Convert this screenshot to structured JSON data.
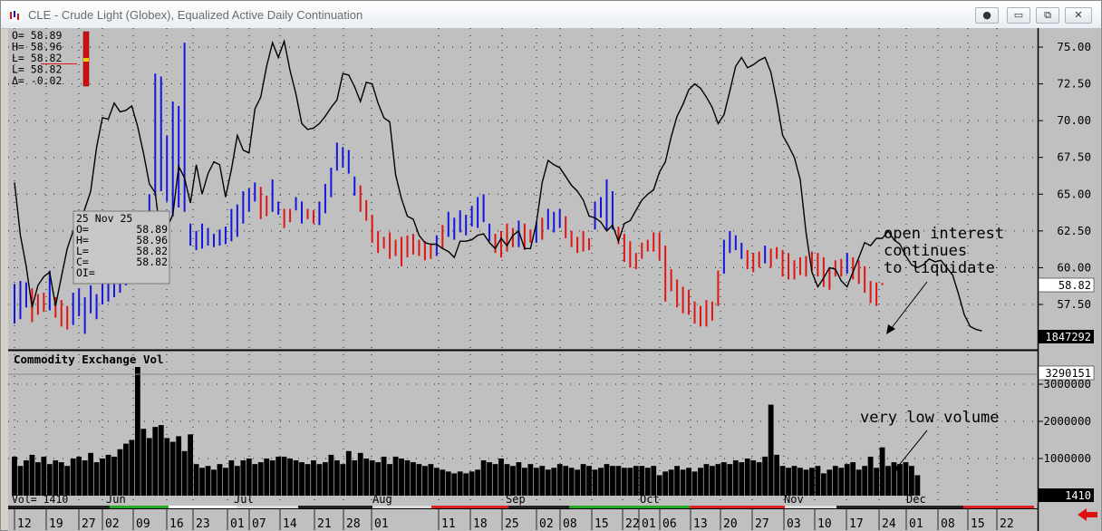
{
  "window": {
    "title": "CLE - Crude Light (Globex), Equalized Active Daily Continuation",
    "buttons": [
      "●",
      "▭",
      "⧉",
      "✕"
    ]
  },
  "ohlc_box": {
    "o": "O=   58.89",
    "h": "H=   58.96",
    "l": "L=   58.82",
    "l2": "L=   58.82",
    "d": "Δ=   -0.02"
  },
  "tooltip": {
    "date": "25 Nov 25",
    "rows": [
      {
        "k": "O=",
        "v": "58.89"
      },
      {
        "k": "H=",
        "v": "58.96"
      },
      {
        "k": "L=",
        "v": "58.82"
      },
      {
        "k": "C=",
        "v": "58.82"
      },
      {
        "k": "OI=",
        "v": ""
      }
    ]
  },
  "annotations": {
    "oi_line1": "open interest",
    "oi_line2": "continues",
    "oi_line3": "to liquidate",
    "vol": "very low volume"
  },
  "volume_panel": {
    "title": "Commodity Exchange Vol",
    "vol_readout": "Vol=     1410",
    "last_value": "1410",
    "oi_value": "1847292",
    "max_value": "3290151"
  },
  "price_last": "58.82",
  "colors": {
    "up": "#1414e0",
    "down": "#e01414",
    "oi_line": "#000000",
    "bg": "#c0c0c0"
  },
  "chart_data": [
    {
      "type": "ohlc",
      "title": "CLE - Crude Light (Globex), Equalized Active Daily Continuation",
      "ylim": [
        55.5,
        76.0
      ],
      "y_ticks": [
        "75.00",
        "72.50",
        "70.00",
        "67.50",
        "65.00",
        "62.50",
        "60.00",
        "57.50"
      ],
      "month_labels": [
        "Jun",
        "Jul",
        "Aug",
        "Sep",
        "Oct",
        "Nov",
        "Dec"
      ],
      "day_labels": [
        "12",
        "19",
        "27",
        "02",
        "09",
        "16",
        "23",
        "01",
        "07",
        "14",
        "21",
        "28",
        "01",
        "11",
        "18",
        "25",
        "02",
        "08",
        "15",
        "22",
        "01",
        "06",
        "13",
        "20",
        "27",
        "03",
        "10",
        "17",
        "24",
        "01",
        "08",
        "15",
        "22"
      ],
      "bars": [
        {
          "h": 58.9,
          "l": 56.2,
          "d": 1
        },
        {
          "h": 59.1,
          "l": 56.5,
          "d": 1
        },
        {
          "h": 59.0,
          "l": 57.3,
          "d": 1
        },
        {
          "h": 58.6,
          "l": 56.3,
          "d": -1
        },
        {
          "h": 58.2,
          "l": 56.8,
          "d": -1
        },
        {
          "h": 58.3,
          "l": 57.0,
          "d": -1
        },
        {
          "h": 59.8,
          "l": 57.1,
          "d": 1
        },
        {
          "h": 58.0,
          "l": 56.6,
          "d": -1
        },
        {
          "h": 57.8,
          "l": 56.0,
          "d": -1
        },
        {
          "h": 57.4,
          "l": 55.8,
          "d": -1
        },
        {
          "h": 58.3,
          "l": 56.1,
          "d": 1
        },
        {
          "h": 58.6,
          "l": 56.7,
          "d": 1
        },
        {
          "h": 58.0,
          "l": 55.5,
          "d": 1
        },
        {
          "h": 58.8,
          "l": 56.9,
          "d": 1
        },
        {
          "h": 58.2,
          "l": 56.5,
          "d": 1
        },
        {
          "h": 59.3,
          "l": 57.5,
          "d": 1
        },
        {
          "h": 59.6,
          "l": 57.7,
          "d": 1
        },
        {
          "h": 60.0,
          "l": 58.0,
          "d": 1
        },
        {
          "h": 59.5,
          "l": 58.3,
          "d": 1
        },
        {
          "h": 60.5,
          "l": 58.8,
          "d": 1
        },
        {
          "h": 61.6,
          "l": 59.5,
          "d": 1
        },
        {
          "h": 61.2,
          "l": 59.6,
          "d": 1
        },
        {
          "h": 63.2,
          "l": 60.6,
          "d": 1
        },
        {
          "h": 65.0,
          "l": 62.8,
          "d": 1
        },
        {
          "h": 73.2,
          "l": 64.9,
          "d": 1
        },
        {
          "h": 73.0,
          "l": 65.2,
          "d": 1
        },
        {
          "h": 69.0,
          "l": 64.5,
          "d": 1
        },
        {
          "h": 71.3,
          "l": 63.5,
          "d": 1
        },
        {
          "h": 71.0,
          "l": 64.1,
          "d": 1
        },
        {
          "h": 75.3,
          "l": 63.8,
          "d": 1
        },
        {
          "h": 63.0,
          "l": 61.5,
          "d": 1
        },
        {
          "h": 62.5,
          "l": 61.2,
          "d": 1
        },
        {
          "h": 63.0,
          "l": 61.3,
          "d": 1
        },
        {
          "h": 62.7,
          "l": 61.5,
          "d": 1
        },
        {
          "h": 62.3,
          "l": 61.4,
          "d": 1
        },
        {
          "h": 62.6,
          "l": 61.5,
          "d": 1
        },
        {
          "h": 62.8,
          "l": 61.6,
          "d": 1
        },
        {
          "h": 64.0,
          "l": 61.8,
          "d": 1
        },
        {
          "h": 64.3,
          "l": 62.1,
          "d": 1
        },
        {
          "h": 65.2,
          "l": 63.0,
          "d": 1
        },
        {
          "h": 65.4,
          "l": 63.8,
          "d": 1
        },
        {
          "h": 65.8,
          "l": 64.5,
          "d": 1
        },
        {
          "h": 65.5,
          "l": 63.3,
          "d": -1
        },
        {
          "h": 64.9,
          "l": 63.5,
          "d": -1
        },
        {
          "h": 66.0,
          "l": 63.8,
          "d": 1
        },
        {
          "h": 64.5,
          "l": 63.6,
          "d": 1
        },
        {
          "h": 64.0,
          "l": 62.7,
          "d": -1
        },
        {
          "h": 64.0,
          "l": 63.1,
          "d": -1
        },
        {
          "h": 64.8,
          "l": 63.9,
          "d": 1
        },
        {
          "h": 64.5,
          "l": 63.0,
          "d": 1
        },
        {
          "h": 64.0,
          "l": 63.3,
          "d": -1
        },
        {
          "h": 63.9,
          "l": 63.0,
          "d": -1
        },
        {
          "h": 64.5,
          "l": 62.9,
          "d": 1
        },
        {
          "h": 65.7,
          "l": 63.7,
          "d": 1
        },
        {
          "h": 66.8,
          "l": 64.8,
          "d": 1
        },
        {
          "h": 68.5,
          "l": 66.6,
          "d": 1
        },
        {
          "h": 68.2,
          "l": 66.8,
          "d": 1
        },
        {
          "h": 68.0,
          "l": 66.4,
          "d": 1
        },
        {
          "h": 66.2,
          "l": 64.9,
          "d": 1
        },
        {
          "h": 65.6,
          "l": 63.8,
          "d": -1
        },
        {
          "h": 64.6,
          "l": 63.2,
          "d": -1
        },
        {
          "h": 63.6,
          "l": 61.7,
          "d": -1
        },
        {
          "h": 62.5,
          "l": 61.0,
          "d": -1
        },
        {
          "h": 62.1,
          "l": 61.3,
          "d": -1
        },
        {
          "h": 62.4,
          "l": 60.6,
          "d": -1
        },
        {
          "h": 61.9,
          "l": 60.8,
          "d": -1
        },
        {
          "h": 62.1,
          "l": 60.1,
          "d": -1
        },
        {
          "h": 62.2,
          "l": 60.7,
          "d": -1
        },
        {
          "h": 62.3,
          "l": 60.9,
          "d": -1
        },
        {
          "h": 61.9,
          "l": 60.8,
          "d": -1
        },
        {
          "h": 61.8,
          "l": 60.5,
          "d": -1
        },
        {
          "h": 61.6,
          "l": 60.6,
          "d": -1
        },
        {
          "h": 62.2,
          "l": 60.8,
          "d": 1
        },
        {
          "h": 62.9,
          "l": 61.3,
          "d": -1
        },
        {
          "h": 63.8,
          "l": 62.1,
          "d": 1
        },
        {
          "h": 63.4,
          "l": 61.9,
          "d": 1
        },
        {
          "h": 63.9,
          "l": 62.4,
          "d": 1
        },
        {
          "h": 63.6,
          "l": 62.2,
          "d": 1
        },
        {
          "h": 64.2,
          "l": 62.8,
          "d": 1
        },
        {
          "h": 64.8,
          "l": 62.7,
          "d": 1
        },
        {
          "h": 65.0,
          "l": 63.1,
          "d": 1
        },
        {
          "h": 63.0,
          "l": 61.8,
          "d": 1
        },
        {
          "h": 62.3,
          "l": 61.0,
          "d": -1
        },
        {
          "h": 62.5,
          "l": 60.7,
          "d": -1
        },
        {
          "h": 63.0,
          "l": 61.1,
          "d": -1
        },
        {
          "h": 62.7,
          "l": 61.4,
          "d": -1
        },
        {
          "h": 63.2,
          "l": 61.4,
          "d": 1
        },
        {
          "h": 63.0,
          "l": 61.2,
          "d": -1
        },
        {
          "h": 62.6,
          "l": 61.7,
          "d": -1
        },
        {
          "h": 63.1,
          "l": 61.7,
          "d": 1
        },
        {
          "h": 63.4,
          "l": 61.9,
          "d": -1
        },
        {
          "h": 64.0,
          "l": 62.6,
          "d": 1
        },
        {
          "h": 63.8,
          "l": 62.4,
          "d": 1
        },
        {
          "h": 64.0,
          "l": 62.7,
          "d": 1
        },
        {
          "h": 63.5,
          "l": 62.0,
          "d": -1
        },
        {
          "h": 62.5,
          "l": 61.4,
          "d": -1
        },
        {
          "h": 62.1,
          "l": 61.0,
          "d": -1
        },
        {
          "h": 62.5,
          "l": 61.1,
          "d": -1
        },
        {
          "h": 62.0,
          "l": 61.2,
          "d": -1
        },
        {
          "h": 64.5,
          "l": 62.6,
          "d": 1
        },
        {
          "h": 64.8,
          "l": 63.4,
          "d": 1
        },
        {
          "h": 66.0,
          "l": 62.6,
          "d": 1
        },
        {
          "h": 65.2,
          "l": 62.6,
          "d": 1
        },
        {
          "h": 62.8,
          "l": 61.6,
          "d": -1
        },
        {
          "h": 62.3,
          "l": 60.4,
          "d": -1
        },
        {
          "h": 61.8,
          "l": 60.0,
          "d": -1
        },
        {
          "h": 61.0,
          "l": 59.9,
          "d": -1
        },
        {
          "h": 61.7,
          "l": 60.6,
          "d": -1
        },
        {
          "h": 61.9,
          "l": 61.1,
          "d": -1
        },
        {
          "h": 62.4,
          "l": 61.1,
          "d": -1
        },
        {
          "h": 62.4,
          "l": 60.5,
          "d": -1
        },
        {
          "h": 61.5,
          "l": 57.7,
          "d": -1
        },
        {
          "h": 59.9,
          "l": 58.4,
          "d": -1
        },
        {
          "h": 59.2,
          "l": 57.3,
          "d": -1
        },
        {
          "h": 58.7,
          "l": 56.9,
          "d": -1
        },
        {
          "h": 58.5,
          "l": 56.8,
          "d": -1
        },
        {
          "h": 57.7,
          "l": 56.2,
          "d": -1
        },
        {
          "h": 57.4,
          "l": 56.0,
          "d": -1
        },
        {
          "h": 57.8,
          "l": 56.0,
          "d": -1
        },
        {
          "h": 57.7,
          "l": 56.4,
          "d": -1
        },
        {
          "h": 59.8,
          "l": 57.4,
          "d": -1
        },
        {
          "h": 61.9,
          "l": 59.6,
          "d": 1
        },
        {
          "h": 62.5,
          "l": 61.0,
          "d": 1
        },
        {
          "h": 62.2,
          "l": 61.2,
          "d": 1
        },
        {
          "h": 61.7,
          "l": 60.6,
          "d": 1
        },
        {
          "h": 61.2,
          "l": 59.9,
          "d": -1
        },
        {
          "h": 61.0,
          "l": 59.7,
          "d": -1
        },
        {
          "h": 61.1,
          "l": 60.0,
          "d": -1
        },
        {
          "h": 61.5,
          "l": 60.3,
          "d": 1
        },
        {
          "h": 61.3,
          "l": 60.0,
          "d": -1
        },
        {
          "h": 61.4,
          "l": 60.6,
          "d": -1
        },
        {
          "h": 61.2,
          "l": 59.4,
          "d": -1
        },
        {
          "h": 61.0,
          "l": 59.2,
          "d": -1
        },
        {
          "h": 60.5,
          "l": 59.2,
          "d": -1
        },
        {
          "h": 60.7,
          "l": 59.5,
          "d": -1
        },
        {
          "h": 60.8,
          "l": 59.4,
          "d": -1
        },
        {
          "h": 61.1,
          "l": 59.8,
          "d": -1
        },
        {
          "h": 61.0,
          "l": 59.4,
          "d": -1
        },
        {
          "h": 60.7,
          "l": 58.7,
          "d": -1
        },
        {
          "h": 60.0,
          "l": 58.5,
          "d": -1
        },
        {
          "h": 60.5,
          "l": 59.4,
          "d": -1
        },
        {
          "h": 60.6,
          "l": 59.4,
          "d": -1
        },
        {
          "h": 61.0,
          "l": 59.6,
          "d": 1
        },
        {
          "h": 60.7,
          "l": 59.2,
          "d": -1
        },
        {
          "h": 60.5,
          "l": 58.9,
          "d": -1
        },
        {
          "h": 60.1,
          "l": 58.3,
          "d": -1
        },
        {
          "h": 59.1,
          "l": 57.6,
          "d": -1
        },
        {
          "h": 59.0,
          "l": 57.4,
          "d": -1
        },
        {
          "h": 58.96,
          "l": 58.82,
          "d": -1
        }
      ],
      "open_interest_line": [
        65.8,
        62.2,
        60.1,
        57.3,
        58.8,
        59.4,
        59.7,
        57.4,
        59.4,
        61.3,
        62.5,
        62.8,
        64.0,
        65.2,
        68.2,
        70.2,
        70.1,
        71.2,
        70.6,
        70.7,
        71.0,
        69.6,
        67.8,
        65.7,
        65.1,
        61.8,
        62.7,
        63.6,
        66.9,
        66.1,
        64.4,
        67.0,
        65.0,
        66.4,
        67.2,
        67.0,
        64.8,
        66.7,
        69.0,
        68.0,
        67.8,
        70.8,
        71.6,
        73.7,
        75.3,
        74.3,
        75.4,
        73.4,
        71.8,
        69.8,
        69.4,
        69.5,
        69.8,
        70.3,
        70.9,
        71.4,
        73.2,
        73.1,
        72.3,
        71.3,
        72.6,
        72.5,
        71.2,
        70.2,
        69.9,
        66.3,
        64.7,
        63.5,
        63.3,
        62.2,
        61.7,
        61.6,
        61.6,
        61.3,
        61.1,
        60.7,
        61.8,
        61.8,
        61.9,
        62.2,
        62.3,
        61.7,
        61.3,
        62.0,
        61.5,
        62.2,
        62.5,
        61.3,
        61.3,
        63.0,
        65.8,
        67.3,
        67.0,
        66.8,
        66.2,
        65.6,
        65.2,
        64.6,
        63.5,
        63.4,
        63.1,
        62.5,
        62.9,
        61.8,
        63.0,
        63.2,
        63.9,
        64.6,
        65.0,
        65.3,
        66.5,
        67.2,
        68.9,
        70.3,
        71.1,
        72.1,
        72.5,
        72.2,
        71.6,
        70.9,
        69.8,
        70.4,
        72.0,
        73.7,
        74.3,
        73.6,
        73.8,
        74.1,
        74.3,
        73.3,
        71.3,
        69.0,
        68.3,
        67.5,
        66.0,
        62.4,
        59.7,
        58.7,
        59.3,
        60.0,
        59.9,
        59.1,
        58.7,
        59.7,
        60.7,
        61.7,
        61.5,
        62.0,
        62.0,
        62.5,
        61.9,
        61.6,
        60.8,
        60.2,
        60.0,
        60.2,
        60.6,
        60.4,
        60.5,
        60.0,
        59.5,
        58.2,
        56.8,
        56.0,
        55.8,
        55.7
      ],
      "open_interest_value": 1847292
    },
    {
      "type": "bar",
      "title": "Commodity Exchange Vol",
      "ylim": [
        0,
        3400000
      ],
      "y_ticks": [
        "3000000",
        "2000000",
        "1000000"
      ],
      "values": [
        1050000,
        800000,
        950000,
        1100000,
        900000,
        1050000,
        850000,
        950000,
        900000,
        800000,
        1000000,
        1050000,
        950000,
        1150000,
        900000,
        1000000,
        1100000,
        1050000,
        1250000,
        1400000,
        1500000,
        3500000,
        1800000,
        1550000,
        1850000,
        1900000,
        1550000,
        1450000,
        1600000,
        1200000,
        1650000,
        850000,
        750000,
        800000,
        700000,
        850000,
        750000,
        950000,
        800000,
        950000,
        1000000,
        850000,
        900000,
        1000000,
        950000,
        1050000,
        1050000,
        1000000,
        950000,
        900000,
        850000,
        950000,
        850000,
        900000,
        1100000,
        950000,
        850000,
        1200000,
        950000,
        1150000,
        1000000,
        950000,
        900000,
        1050000,
        850000,
        1050000,
        1000000,
        950000,
        900000,
        850000,
        800000,
        850000,
        750000,
        700000,
        650000,
        600000,
        650000,
        600000,
        650000,
        700000,
        950000,
        900000,
        850000,
        1000000,
        850000,
        800000,
        900000,
        750000,
        850000,
        750000,
        800000,
        700000,
        750000,
        850000,
        800000,
        750000,
        700000,
        850000,
        800000,
        700000,
        750000,
        850000,
        800000,
        800000,
        750000,
        750000,
        800000,
        800000,
        750000,
        800000,
        550000,
        650000,
        700000,
        800000,
        700000,
        750000,
        650000,
        750000,
        850000,
        800000,
        850000,
        900000,
        850000,
        950000,
        900000,
        1000000,
        950000,
        900000,
        1050000,
        2450000,
        1100000,
        800000,
        750000,
        800000,
        750000,
        700000,
        750000,
        800000,
        600000,
        700000,
        800000,
        750000,
        850000,
        900000,
        700000,
        800000,
        1050000,
        750000,
        1300000,
        800000,
        900000,
        850000,
        900000,
        800000,
        550000,
        1410
      ],
      "volume_value": 1410
    }
  ]
}
